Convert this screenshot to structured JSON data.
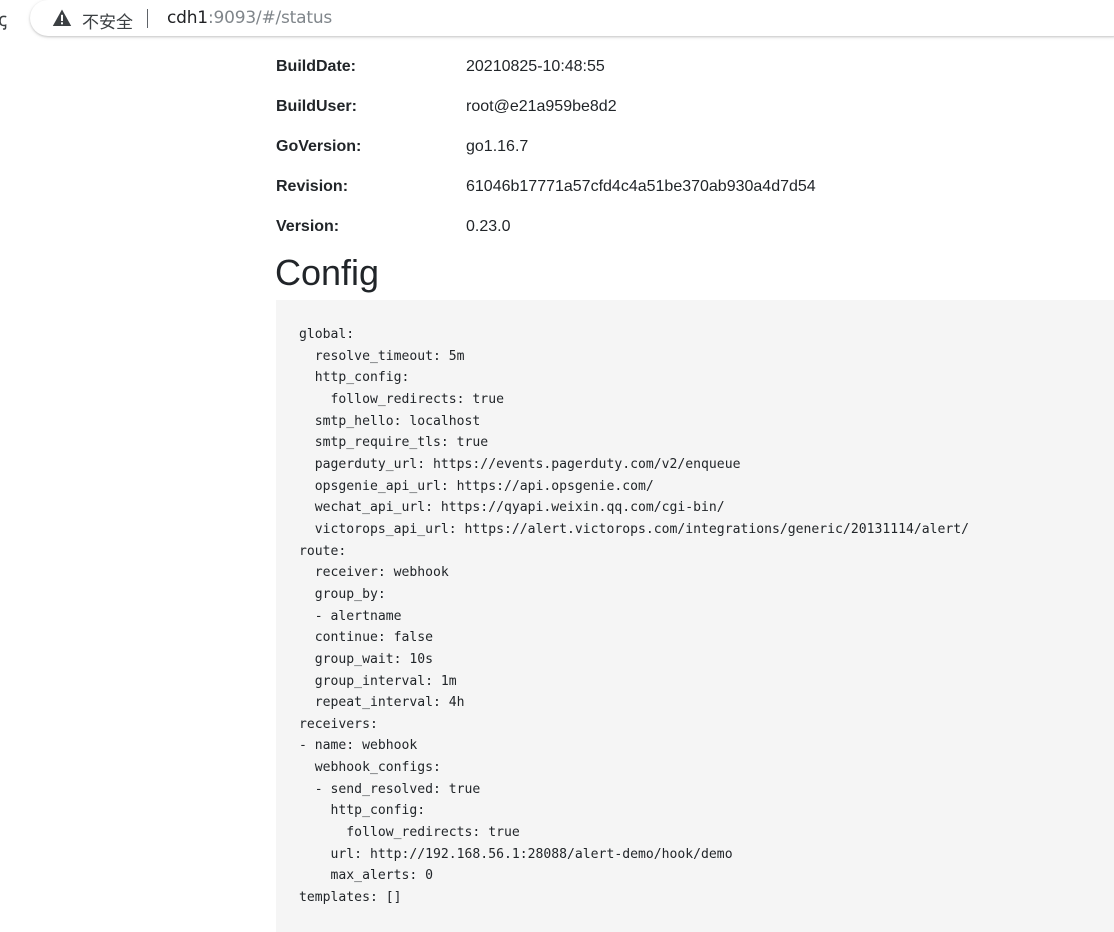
{
  "browser": {
    "security_label": "不安全",
    "url_host": "cdh1",
    "url_rest": ":9093/#/status",
    "edge_glyph": "ꞔ"
  },
  "build_info": [
    {
      "key": "BuildDate:",
      "value": "20210825-10:48:55"
    },
    {
      "key": "BuildUser:",
      "value": "root@e21a959be8d2"
    },
    {
      "key": "GoVersion:",
      "value": "go1.16.7"
    },
    {
      "key": "Revision:",
      "value": "61046b17771a57cfd4c4a51be370ab930a4d7d54"
    },
    {
      "key": "Version:",
      "value": "0.23.0"
    }
  ],
  "config": {
    "heading": "Config",
    "text": "global:\n  resolve_timeout: 5m\n  http_config:\n    follow_redirects: true\n  smtp_hello: localhost\n  smtp_require_tls: true\n  pagerduty_url: https://events.pagerduty.com/v2/enqueue\n  opsgenie_api_url: https://api.opsgenie.com/\n  wechat_api_url: https://qyapi.weixin.qq.com/cgi-bin/\n  victorops_api_url: https://alert.victorops.com/integrations/generic/20131114/alert/\nroute:\n  receiver: webhook\n  group_by:\n  - alertname\n  continue: false\n  group_wait: 10s\n  group_interval: 1m\n  repeat_interval: 4h\nreceivers:\n- name: webhook\n  webhook_configs:\n  - send_resolved: true\n    http_config:\n      follow_redirects: true\n    url: http://192.168.56.1:28088/alert-demo/hook/demo\n    max_alerts: 0\ntemplates: []"
  },
  "colors": {
    "text": "#212529",
    "code_background": "#f5f5f5",
    "url_secondary": "#80868b"
  },
  "icons": {
    "security": "warning-triangle-icon"
  }
}
